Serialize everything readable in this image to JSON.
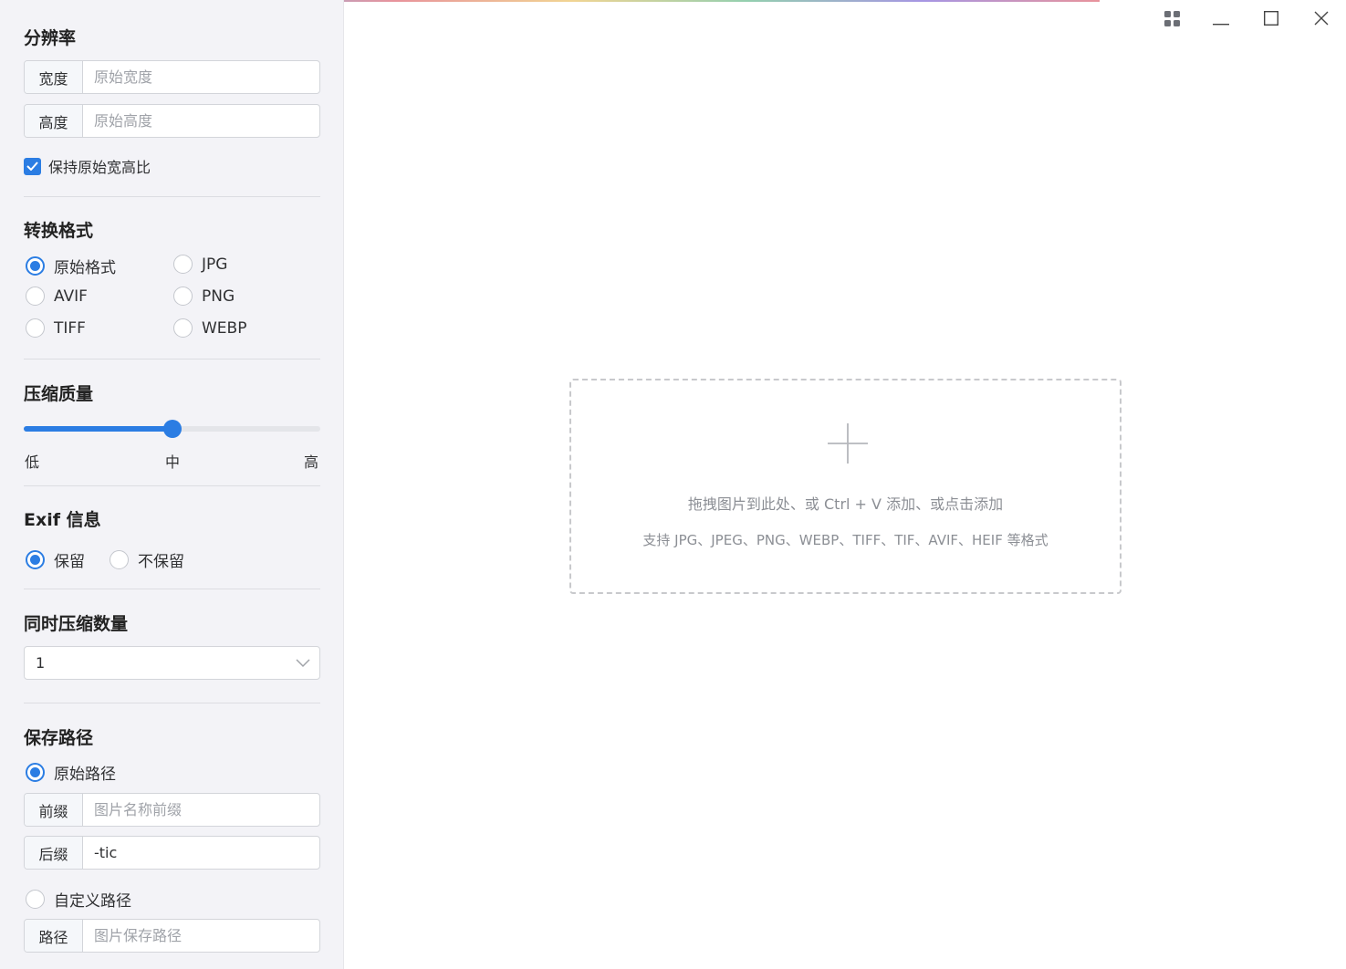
{
  "resolution": {
    "title": "分辨率",
    "width_label": "宽度",
    "width_placeholder": "原始宽度",
    "height_label": "高度",
    "height_placeholder": "原始高度",
    "keep_ratio_label": "保持原始宽高比",
    "keep_ratio_checked": true
  },
  "format": {
    "title": "转换格式",
    "options": [
      "原始格式",
      "JPG",
      "AVIF",
      "PNG",
      "TIFF",
      "WEBP"
    ],
    "selected": "原始格式"
  },
  "quality": {
    "title": "压缩质量",
    "labels": [
      "低",
      "中",
      "高"
    ],
    "value_fraction": 0.5
  },
  "exif": {
    "title": "Exif 信息",
    "options": [
      "保留",
      "不保留"
    ],
    "selected": "保留"
  },
  "concurrency": {
    "title": "同时压缩数量",
    "value": "1"
  },
  "save_path": {
    "title": "保存路径",
    "original_label": "原始路径",
    "prefix_label": "前缀",
    "prefix_placeholder": "图片名称前缀",
    "suffix_label": "后缀",
    "suffix_value": "-tic",
    "custom_label": "自定义路径",
    "path_label": "路径",
    "path_placeholder": "图片保存路径",
    "selected": "原始路径"
  },
  "dropzone": {
    "line1": "拖拽图片到此处、或 Ctrl + V 添加、或点击添加",
    "line2": "支持 JPG、JPEG、PNG、WEBP、TIFF、TIF、AVIF、HEIF 等格式"
  },
  "window_controls": [
    "grid-icon",
    "minimize-icon",
    "maximize-icon",
    "close-icon"
  ],
  "colors": {
    "accent": "#2b7de3",
    "sidebar_bg": "#f3f3f7"
  }
}
